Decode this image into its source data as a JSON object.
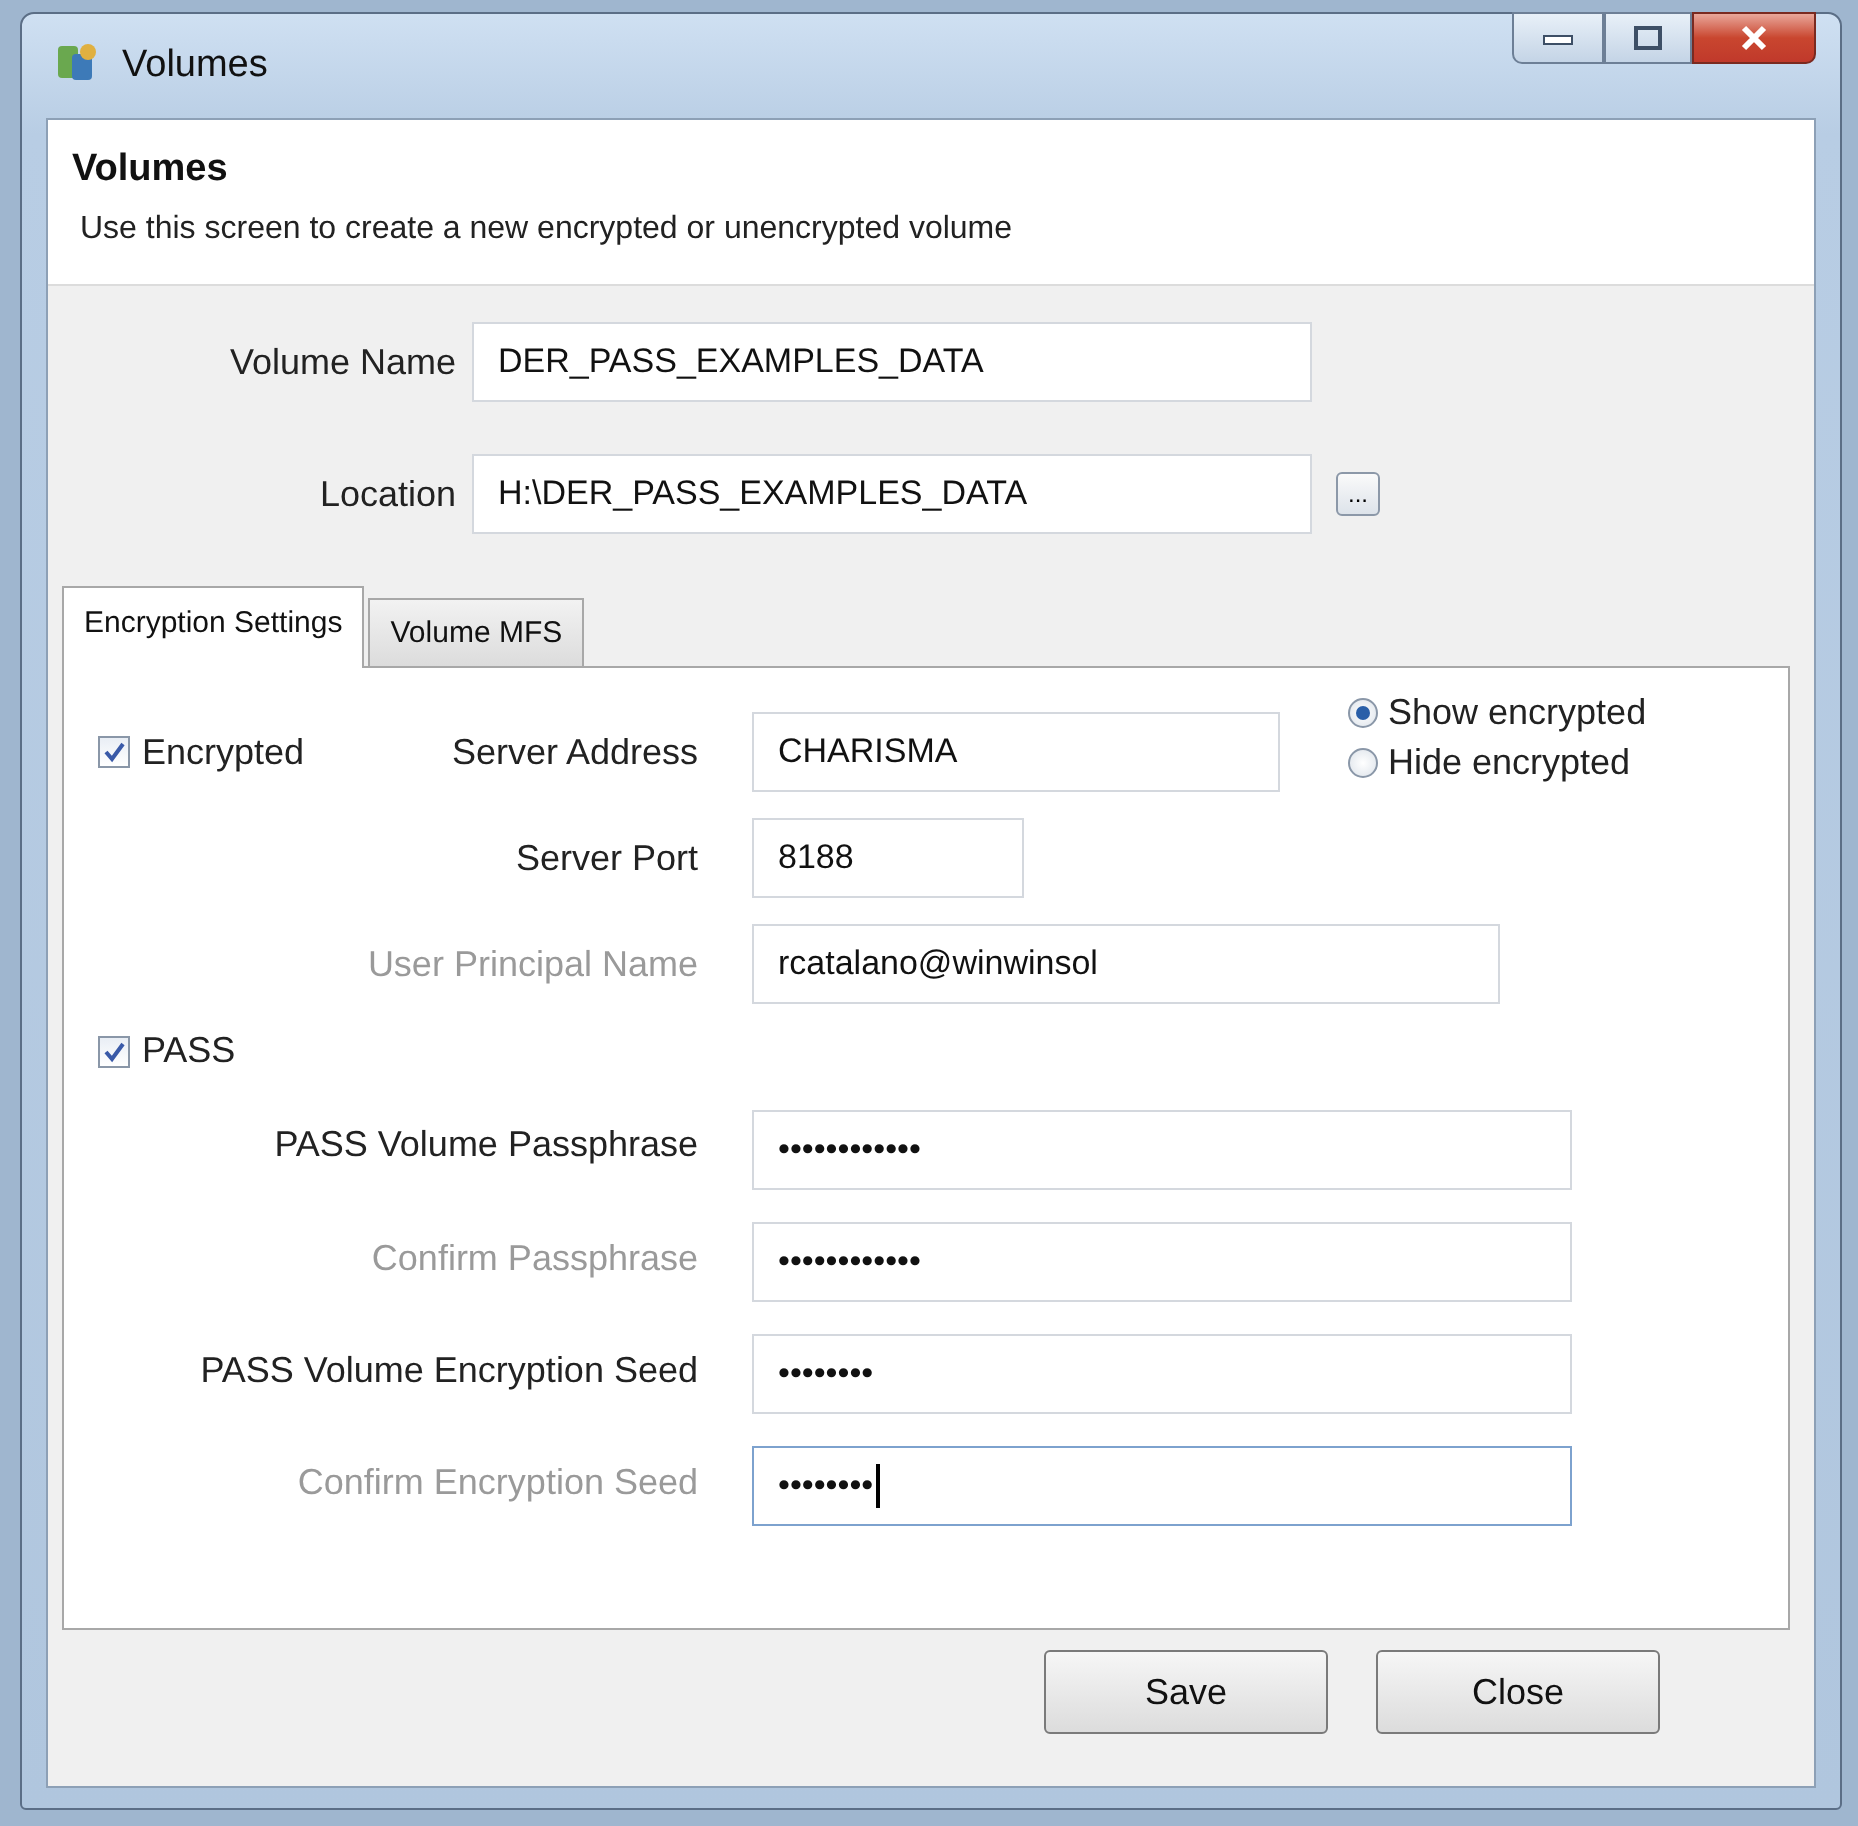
{
  "window": {
    "title": "Volumes"
  },
  "header": {
    "title": "Volumes",
    "description": "Use this screen to create a new encrypted or unencrypted volume"
  },
  "fields": [
    {
      "label": "Volume Name",
      "value": "DER_PASS_EXAMPLES_DATA"
    },
    {
      "label": "Location",
      "value": "H:\\DER_PASS_EXAMPLES_DATA",
      "browse_button": "..."
    }
  ],
  "tabs": [
    {
      "label": "Encryption Settings",
      "selected": true
    },
    {
      "label": "Volume MFS",
      "selected": false
    }
  ],
  "encryption": {
    "encrypted": {
      "label": "Encrypted",
      "checked": true
    },
    "server_fields": [
      {
        "label": "Server Address",
        "value": "CHARISMA",
        "dimmed": false
      },
      {
        "label": "Server Port",
        "value": "8188",
        "dimmed": false
      },
      {
        "label": "User Principal Name",
        "value": "rcatalano@winwinsol",
        "dimmed": true
      }
    ],
    "display_options": [
      {
        "label": "Show encrypted",
        "selected": true
      },
      {
        "label": "Hide encrypted",
        "selected": false
      }
    ],
    "pass": {
      "label": "PASS",
      "checked": true
    },
    "pass_fields": [
      {
        "label": "PASS Volume Passphrase",
        "value": "••••••••••••",
        "dimmed": false,
        "focused": false
      },
      {
        "label": "Confirm Passphrase",
        "value": "••••••••••••",
        "dimmed": true,
        "focused": false
      },
      {
        "label": "PASS Volume Encryption Seed",
        "value": "••••••••",
        "dimmed": false,
        "focused": false
      },
      {
        "label": "Confirm Encryption Seed",
        "value": "••••••••",
        "dimmed": true,
        "focused": true
      }
    ]
  },
  "buttons": [
    {
      "label": "Save"
    },
    {
      "label": "Close"
    }
  ]
}
